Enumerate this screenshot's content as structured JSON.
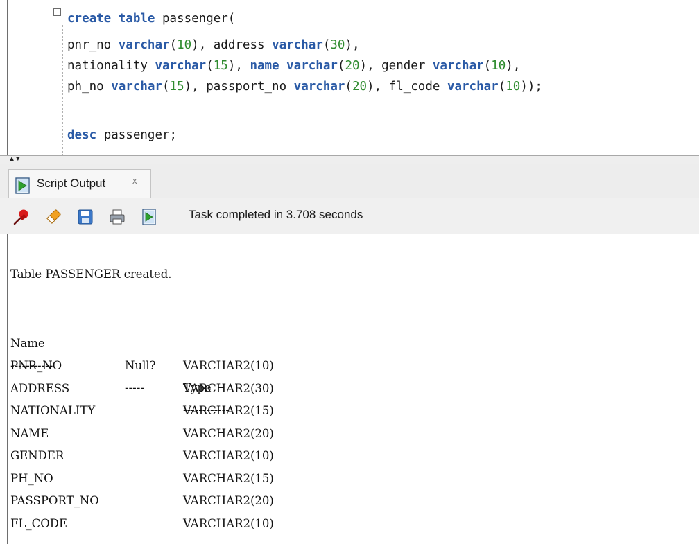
{
  "editor": {
    "lines": [
      [
        {
          "t": "create",
          "k": "kw"
        },
        {
          "t": " ",
          "k": "plain"
        },
        {
          "t": "table",
          "k": "kw"
        },
        {
          "t": " passenger(",
          "k": "plain"
        }
      ],
      [
        {
          "t": "pnr_no ",
          "k": "plain"
        },
        {
          "t": "varchar",
          "k": "kw"
        },
        {
          "t": "(",
          "k": "plain"
        },
        {
          "t": "10",
          "k": "num"
        },
        {
          "t": "), address ",
          "k": "plain"
        },
        {
          "t": "varchar",
          "k": "kw"
        },
        {
          "t": "(",
          "k": "plain"
        },
        {
          "t": "30",
          "k": "num"
        },
        {
          "t": "),",
          "k": "plain"
        }
      ],
      [
        {
          "t": "nationality ",
          "k": "plain"
        },
        {
          "t": "varchar",
          "k": "kw"
        },
        {
          "t": "(",
          "k": "plain"
        },
        {
          "t": "15",
          "k": "num"
        },
        {
          "t": "), ",
          "k": "plain"
        },
        {
          "t": "name",
          "k": "kw"
        },
        {
          "t": " ",
          "k": "plain"
        },
        {
          "t": "varchar",
          "k": "kw"
        },
        {
          "t": "(",
          "k": "plain"
        },
        {
          "t": "20",
          "k": "num"
        },
        {
          "t": "), gender ",
          "k": "plain"
        },
        {
          "t": "varchar",
          "k": "kw"
        },
        {
          "t": "(",
          "k": "plain"
        },
        {
          "t": "10",
          "k": "num"
        },
        {
          "t": "),",
          "k": "plain"
        }
      ],
      [
        {
          "t": "ph_no ",
          "k": "plain"
        },
        {
          "t": "varchar",
          "k": "kw"
        },
        {
          "t": "(",
          "k": "plain"
        },
        {
          "t": "15",
          "k": "num"
        },
        {
          "t": "), passport_no ",
          "k": "plain"
        },
        {
          "t": "varchar",
          "k": "kw"
        },
        {
          "t": "(",
          "k": "plain"
        },
        {
          "t": "20",
          "k": "num"
        },
        {
          "t": "), fl_code ",
          "k": "plain"
        },
        {
          "t": "varchar",
          "k": "kw"
        },
        {
          "t": "(",
          "k": "plain"
        },
        {
          "t": "10",
          "k": "num"
        },
        {
          "t": "));",
          "k": "plain"
        }
      ],
      [],
      [
        {
          "t": "desc",
          "k": "kw"
        },
        {
          "t": " passenger;",
          "k": "plain"
        }
      ]
    ]
  },
  "output_panel": {
    "tab_label": "Script Output",
    "tab_close": "x",
    "status_text": "Task completed in 3.708 seconds",
    "icons": [
      "pin-icon",
      "eraser-icon",
      "save-icon",
      "print-icon",
      "script-icon"
    ]
  },
  "output": {
    "created_message": "Table PASSENGER created.",
    "headers": {
      "name": "Name",
      "null": "Null?",
      "type": "Type"
    },
    "dashes": {
      "name": "-----------",
      "null": "-----",
      "type": "------------"
    },
    "rows": [
      {
        "name": "PNR_NO",
        "null": "",
        "type": "VARCHAR2(10)"
      },
      {
        "name": "ADDRESS",
        "null": "",
        "type": "VARCHAR2(30)"
      },
      {
        "name": "NATIONALITY",
        "null": "",
        "type": "VARCHAR2(15)"
      },
      {
        "name": "NAME",
        "null": "",
        "type": "VARCHAR2(20)"
      },
      {
        "name": "GENDER",
        "null": "",
        "type": "VARCHAR2(10)"
      },
      {
        "name": "PH_NO",
        "null": "",
        "type": "VARCHAR2(15)"
      },
      {
        "name": "PASSPORT_NO",
        "null": "",
        "type": "VARCHAR2(20)"
      },
      {
        "name": "FL_CODE",
        "null": "",
        "type": "VARCHAR2(10)"
      }
    ]
  }
}
